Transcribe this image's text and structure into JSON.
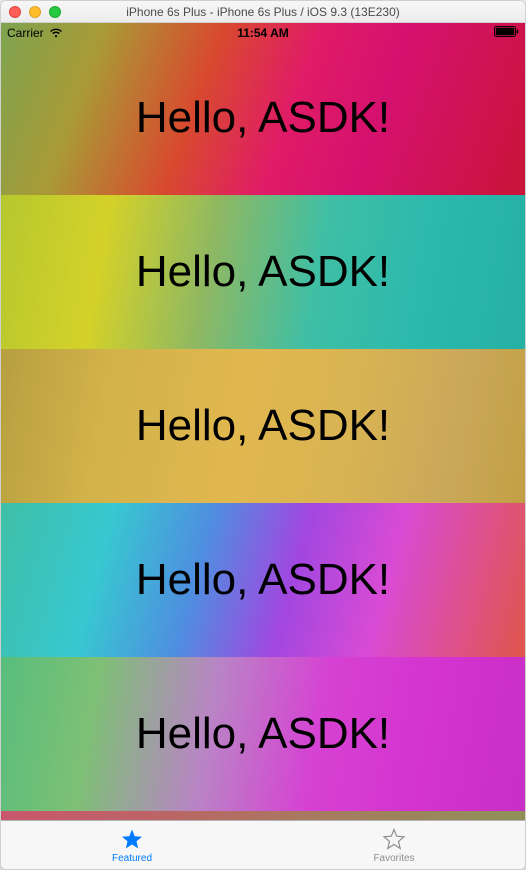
{
  "window": {
    "title": "iPhone 6s Plus - iPhone 6s Plus / iOS 9.3 (13E230)"
  },
  "statusBar": {
    "carrier": "Carrier",
    "time": "11:54 AM"
  },
  "rows": [
    {
      "text": "Hello, ASDK!"
    },
    {
      "text": "Hello, ASDK!"
    },
    {
      "text": "Hello, ASDK!"
    },
    {
      "text": "Hello, ASDK!"
    },
    {
      "text": "Hello, ASDK!"
    }
  ],
  "tabs": {
    "featured": {
      "label": "Featured"
    },
    "favorites": {
      "label": "Favorites"
    }
  }
}
